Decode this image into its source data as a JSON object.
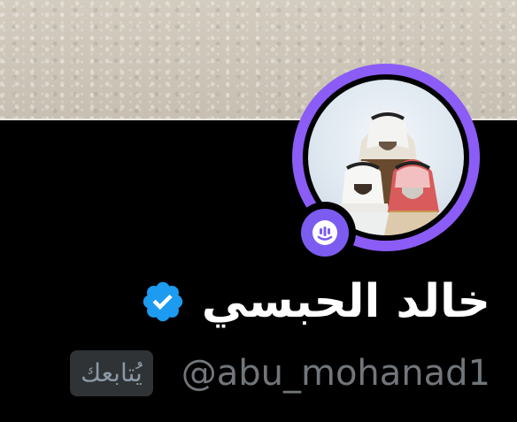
{
  "profile": {
    "display_name": "خالد الحبسي",
    "handle": "@abu_mohanad1",
    "follows_you_label": "يُتابعك"
  },
  "icons": {
    "verified": "verified-badge-icon",
    "space": "spaces-microphone-icon"
  },
  "colors": {
    "avatar_ring": "#8b5cf6",
    "verified_blue": "#1d9bf0",
    "space_badge": "#7c5cf0",
    "background": "#000000"
  }
}
